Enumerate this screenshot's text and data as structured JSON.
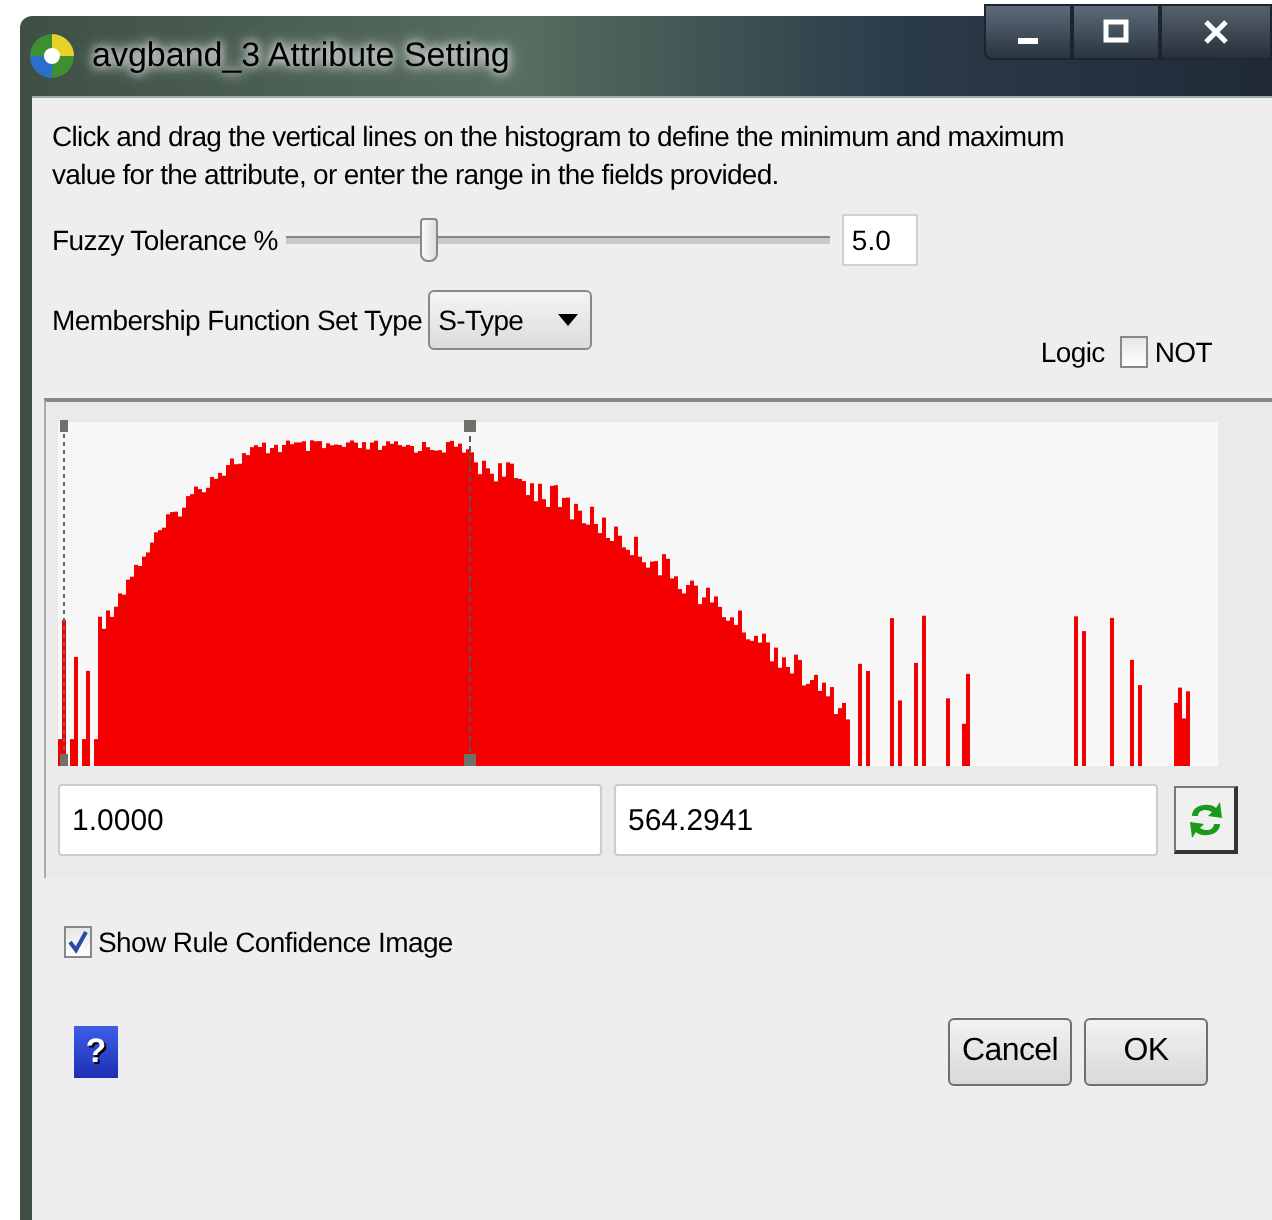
{
  "window": {
    "title": "avgband_3 Attribute Setting"
  },
  "description": "Click and drag the vertical lines on the histogram to define the minimum and maximum value for the attribute, or enter the range in the fields provided.",
  "fuzzy_tolerance": {
    "label": "Fuzzy Tolerance %",
    "level": 0.26,
    "value": "5.0"
  },
  "membership": {
    "label": "Membership Function Set Type",
    "value": "S-Type"
  },
  "logic": {
    "label": "Logic",
    "option": "NOT",
    "checked": false
  },
  "range": {
    "min": "1.0000",
    "max": "564.2941"
  },
  "show_confidence": {
    "label": "Show Rule Confidence Image",
    "checked": true
  },
  "help": "?",
  "buttons": [
    "Cancel",
    "OK"
  ]
}
